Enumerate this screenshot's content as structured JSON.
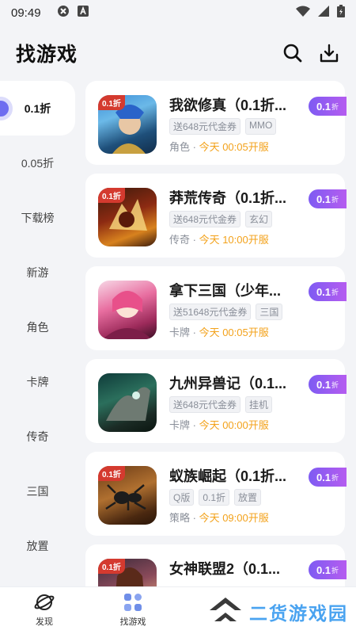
{
  "status_bar": {
    "time": "09:49"
  },
  "header": {
    "title": "找游戏"
  },
  "sidebar": {
    "items": [
      {
        "label": "0.1折",
        "active": true
      },
      {
        "label": "0.05折"
      },
      {
        "label": "下载榜"
      },
      {
        "label": "新游"
      },
      {
        "label": "角色"
      },
      {
        "label": "卡牌"
      },
      {
        "label": "传奇"
      },
      {
        "label": "三国"
      },
      {
        "label": "放置"
      }
    ]
  },
  "games": [
    {
      "name": "我欲修真（0.1折...",
      "tags": [
        "送648元代金券",
        "MMO"
      ],
      "category": "角色",
      "open_time": "今天 00:05开服",
      "badge": "0.1",
      "badge_unit": "折",
      "ribbon": "0.1折"
    },
    {
      "name": "莽荒传奇（0.1折...",
      "tags": [
        "送648元代金券",
        "玄幻"
      ],
      "category": "传奇",
      "open_time": "今天 10:00开服",
      "badge": "0.1",
      "badge_unit": "折",
      "ribbon": "0.1折"
    },
    {
      "name": "拿下三国（少年...",
      "tags": [
        "送51648元代金券",
        "三国"
      ],
      "category": "卡牌",
      "open_time": "今天 00:05开服",
      "badge": "0.1",
      "badge_unit": "折",
      "ribbon": ""
    },
    {
      "name": "九州异兽记（0.1...",
      "tags": [
        "送648元代金券",
        "挂机"
      ],
      "category": "卡牌",
      "open_time": "今天 00:00开服",
      "badge": "0.1",
      "badge_unit": "折",
      "ribbon": ""
    },
    {
      "name": "蚁族崛起（0.1折...",
      "tags": [
        "Q版",
        "0.1折",
        "放置"
      ],
      "category": "策略",
      "open_time": "今天 09:00开服",
      "badge": "0.1",
      "badge_unit": "折",
      "ribbon": "0.1折"
    },
    {
      "name": "女神联盟2（0.1...",
      "tags": [],
      "category": "",
      "open_time": "",
      "badge": "0.1",
      "badge_unit": "折",
      "ribbon": "0.1折"
    }
  ],
  "bottom_nav": {
    "items": [
      {
        "label": "发现",
        "icon": "planet-icon"
      },
      {
        "label": "找游戏",
        "icon": "grid-icon",
        "active": true
      }
    ]
  },
  "watermark": {
    "text": "二货游戏园"
  },
  "colors": {
    "accent": "#7e5bf2",
    "open_time": "#f3a21b",
    "watermark": "#4aa3f0"
  }
}
